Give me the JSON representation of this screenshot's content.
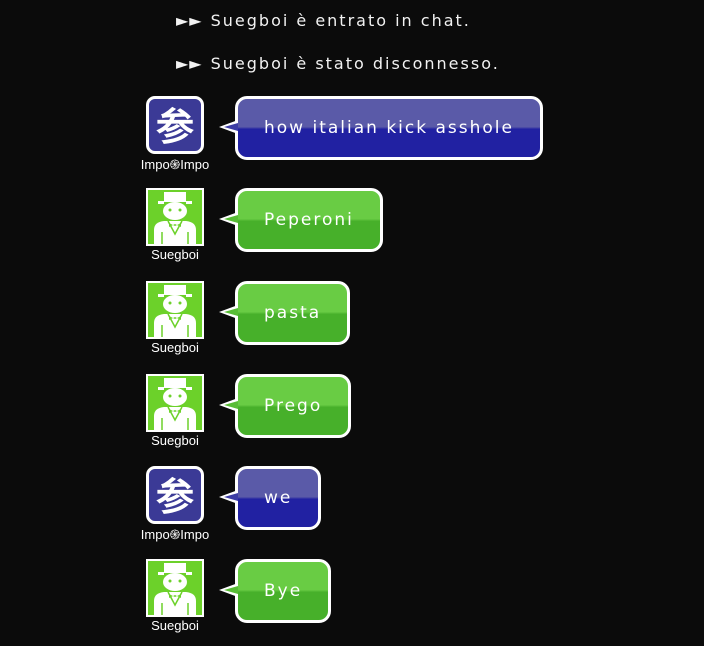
{
  "system_messages": [
    {
      "arrows": "►►",
      "text": "Suegboi è entrato in chat."
    },
    {
      "arrows": "►►",
      "text": "Suegboi è stato disconnesso."
    }
  ],
  "messages": [
    {
      "user": "Impo֍Impo",
      "avatar": "kanji-avatar-icon",
      "avatar_glyph": "参",
      "text": "how italian kick asshole",
      "color": "blue"
    },
    {
      "user": "Suegboi",
      "avatar": "top-hat-man-avatar-icon",
      "text": "Peperoni",
      "color": "green"
    },
    {
      "user": "Suegboi",
      "avatar": "top-hat-man-avatar-icon",
      "text": "pasta",
      "color": "green"
    },
    {
      "user": "Suegboi",
      "avatar": "top-hat-man-avatar-icon",
      "text": "Prego",
      "color": "green"
    },
    {
      "user": "Impo֍Impo",
      "avatar": "kanji-avatar-icon",
      "avatar_glyph": "参",
      "text": "we",
      "color": "blue"
    },
    {
      "user": "Suegboi",
      "avatar": "top-hat-man-avatar-icon",
      "text": "Bye",
      "color": "green"
    }
  ],
  "colors": {
    "background": "#0b0b0b",
    "green_bubble_top": "#69cc44",
    "green_bubble_bottom": "#47b02a",
    "blue_bubble_top": "#5a5aa8",
    "blue_bubble_bottom": "#2121a2",
    "green_avatar": "#6cd12a",
    "blue_avatar": "#3b3a96"
  }
}
